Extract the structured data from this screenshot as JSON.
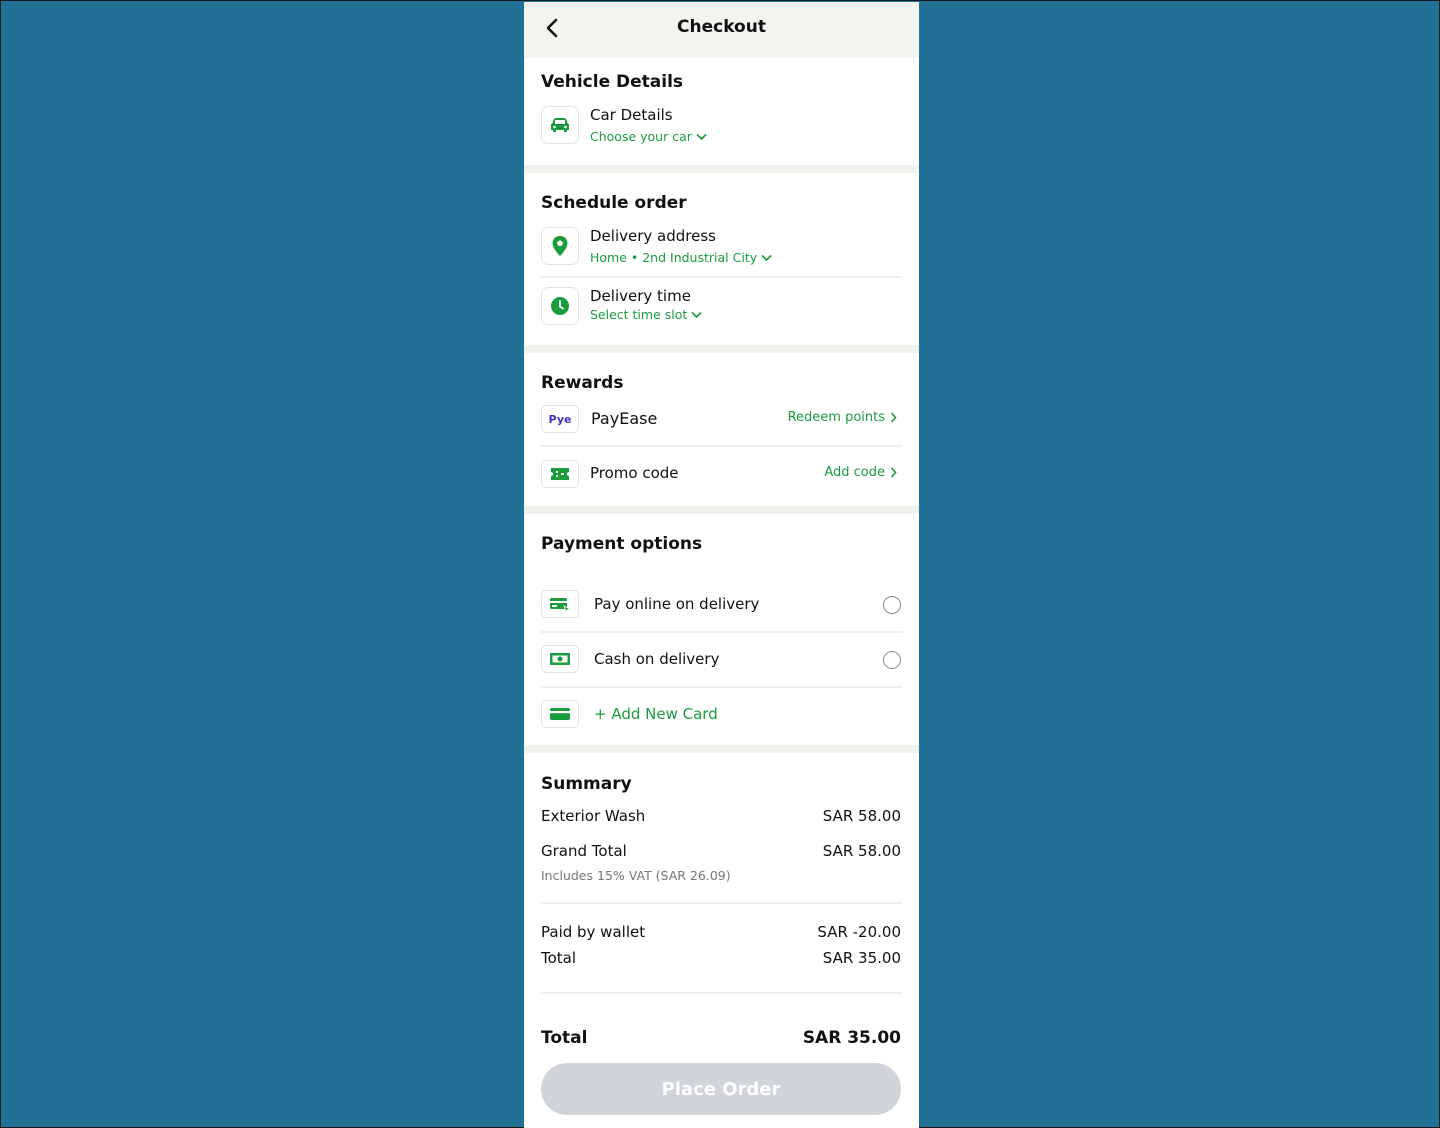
{
  "header": {
    "title": "Checkout",
    "back_icon": "chevron-left-icon"
  },
  "vehicle": {
    "title": "Vehicle Details",
    "car_label": "Car Details",
    "car_sub": "Choose your car"
  },
  "schedule": {
    "title": "Schedule order",
    "address_label": "Delivery address",
    "address_sub": "Home • 2nd Industrial City",
    "time_label": "Delivery time",
    "time_sub": "Select time slot"
  },
  "rewards": {
    "title": "Rewards",
    "payease_logo": "Pye",
    "payease_label": "PayEase",
    "payease_action": "Redeem points",
    "promo_label": "Promo code",
    "promo_action": "Add code"
  },
  "payment": {
    "title": "Payment options",
    "online_label": "Pay online on delivery",
    "cash_label": "Cash on delivery",
    "add_card_label": "+ Add New Card"
  },
  "summary": {
    "title": "Summary",
    "exterior_label": "Exterior Wash",
    "exterior_value": "SAR 58.00",
    "grand_label": "Grand Total",
    "grand_value": "SAR 58.00",
    "vat_note": "Includes 15% VAT (SAR 26.09)",
    "wallet_label": "Paid by wallet",
    "wallet_value": "SAR -20.00",
    "subtotal_label": "Total",
    "subtotal_value": "SAR 35.00",
    "total_label": "Total",
    "total_value": "SAR 35.00"
  },
  "place_order_label": "Place Order",
  "colors": {
    "accent": "#1a9c3d",
    "background": "#217196",
    "button_disabled": "#d1d4d9"
  }
}
